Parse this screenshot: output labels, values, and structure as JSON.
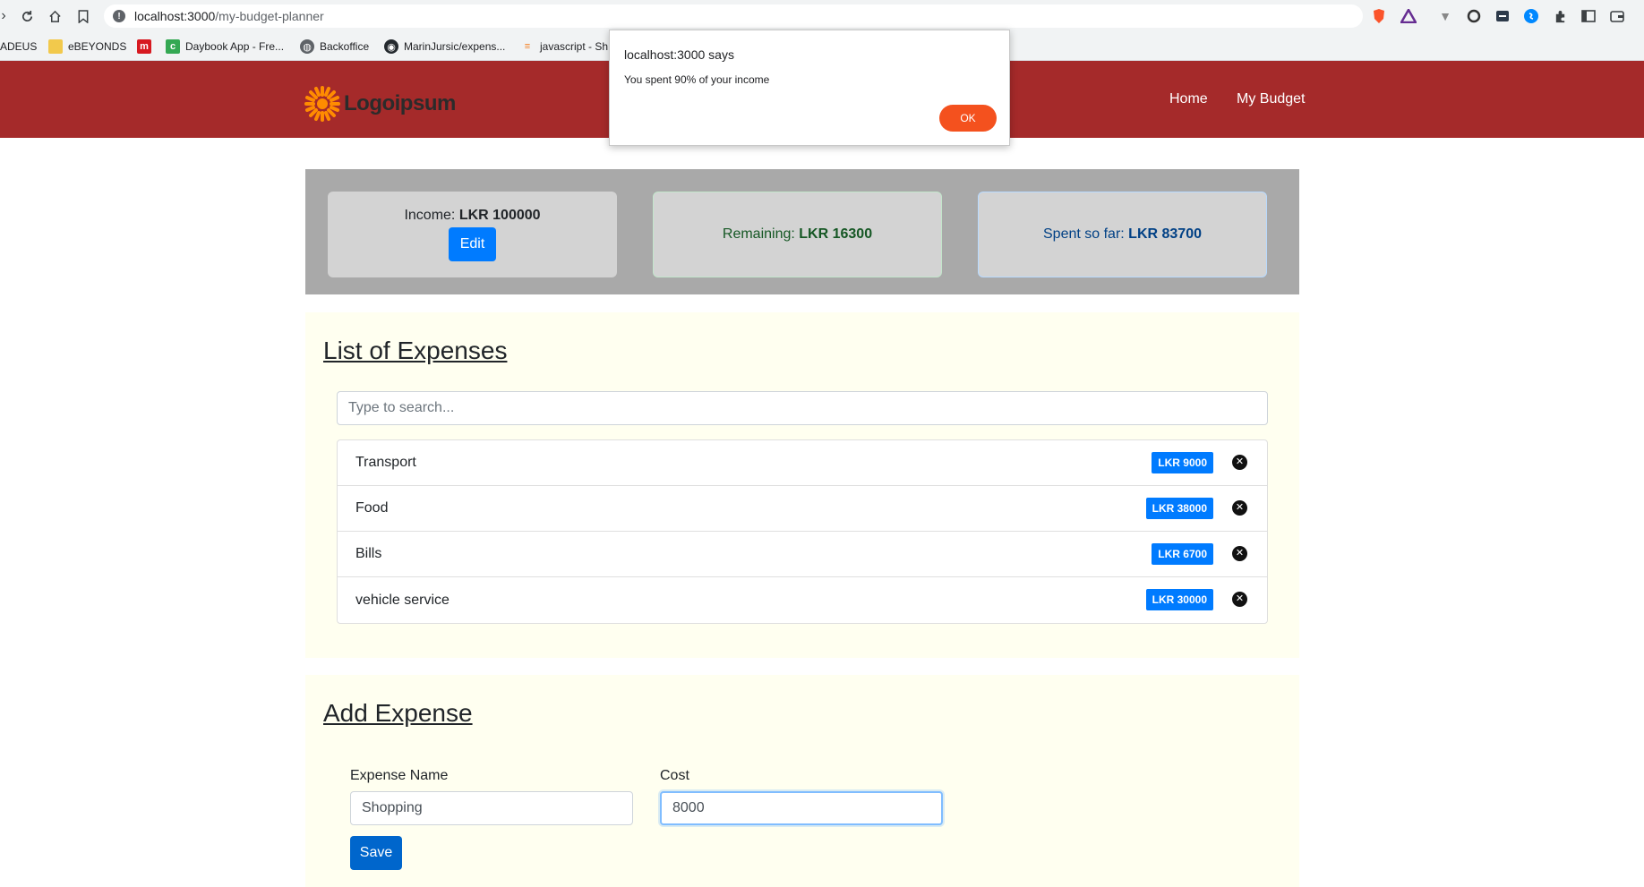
{
  "browser": {
    "url_host": "localhost:3000",
    "url_path": "/my-budget-planner",
    "bookmarks": [
      {
        "label": "ADEUS"
      },
      {
        "label": "eBEYONDS"
      },
      {
        "label": ""
      },
      {
        "label": "Daybook App - Fre..."
      },
      {
        "label": "Backoffice"
      },
      {
        "label": "MarinJursic/expens..."
      },
      {
        "label": "javascript - Sh"
      }
    ]
  },
  "app": {
    "logo_text": "Logoipsum",
    "nav": [
      "Home",
      "My Budget"
    ]
  },
  "summary": {
    "income_label": "Income:",
    "income_value": "LKR 100000",
    "edit_label": "Edit",
    "remaining_label": "Remaining:",
    "remaining_value": "LKR 16300",
    "spent_label": "Spent so far:",
    "spent_value": "LKR 83700"
  },
  "expenses": {
    "title": "List of Expenses",
    "search_placeholder": "Type to search...",
    "items": [
      {
        "name": "Transport",
        "cost": "LKR 9000"
      },
      {
        "name": "Food",
        "cost": "LKR 38000"
      },
      {
        "name": "Bills",
        "cost": "LKR 6700"
      },
      {
        "name": "vehicle service",
        "cost": "LKR 30000"
      }
    ]
  },
  "add_expense": {
    "title": "Add Expense",
    "name_label": "Expense Name",
    "name_value": "Shopping",
    "cost_label": "Cost",
    "cost_value": "8000",
    "save_label": "Save"
  },
  "dialog": {
    "title": "localhost:3000 says",
    "message": "You spent 90% of your income",
    "ok_label": "OK"
  },
  "colors": {
    "navbar": "#a52a2a",
    "badge": "#007bff",
    "section_bg": "#fffff0",
    "summary_bg": "#a9a9a9",
    "dialog_ok": "#f4511e"
  }
}
